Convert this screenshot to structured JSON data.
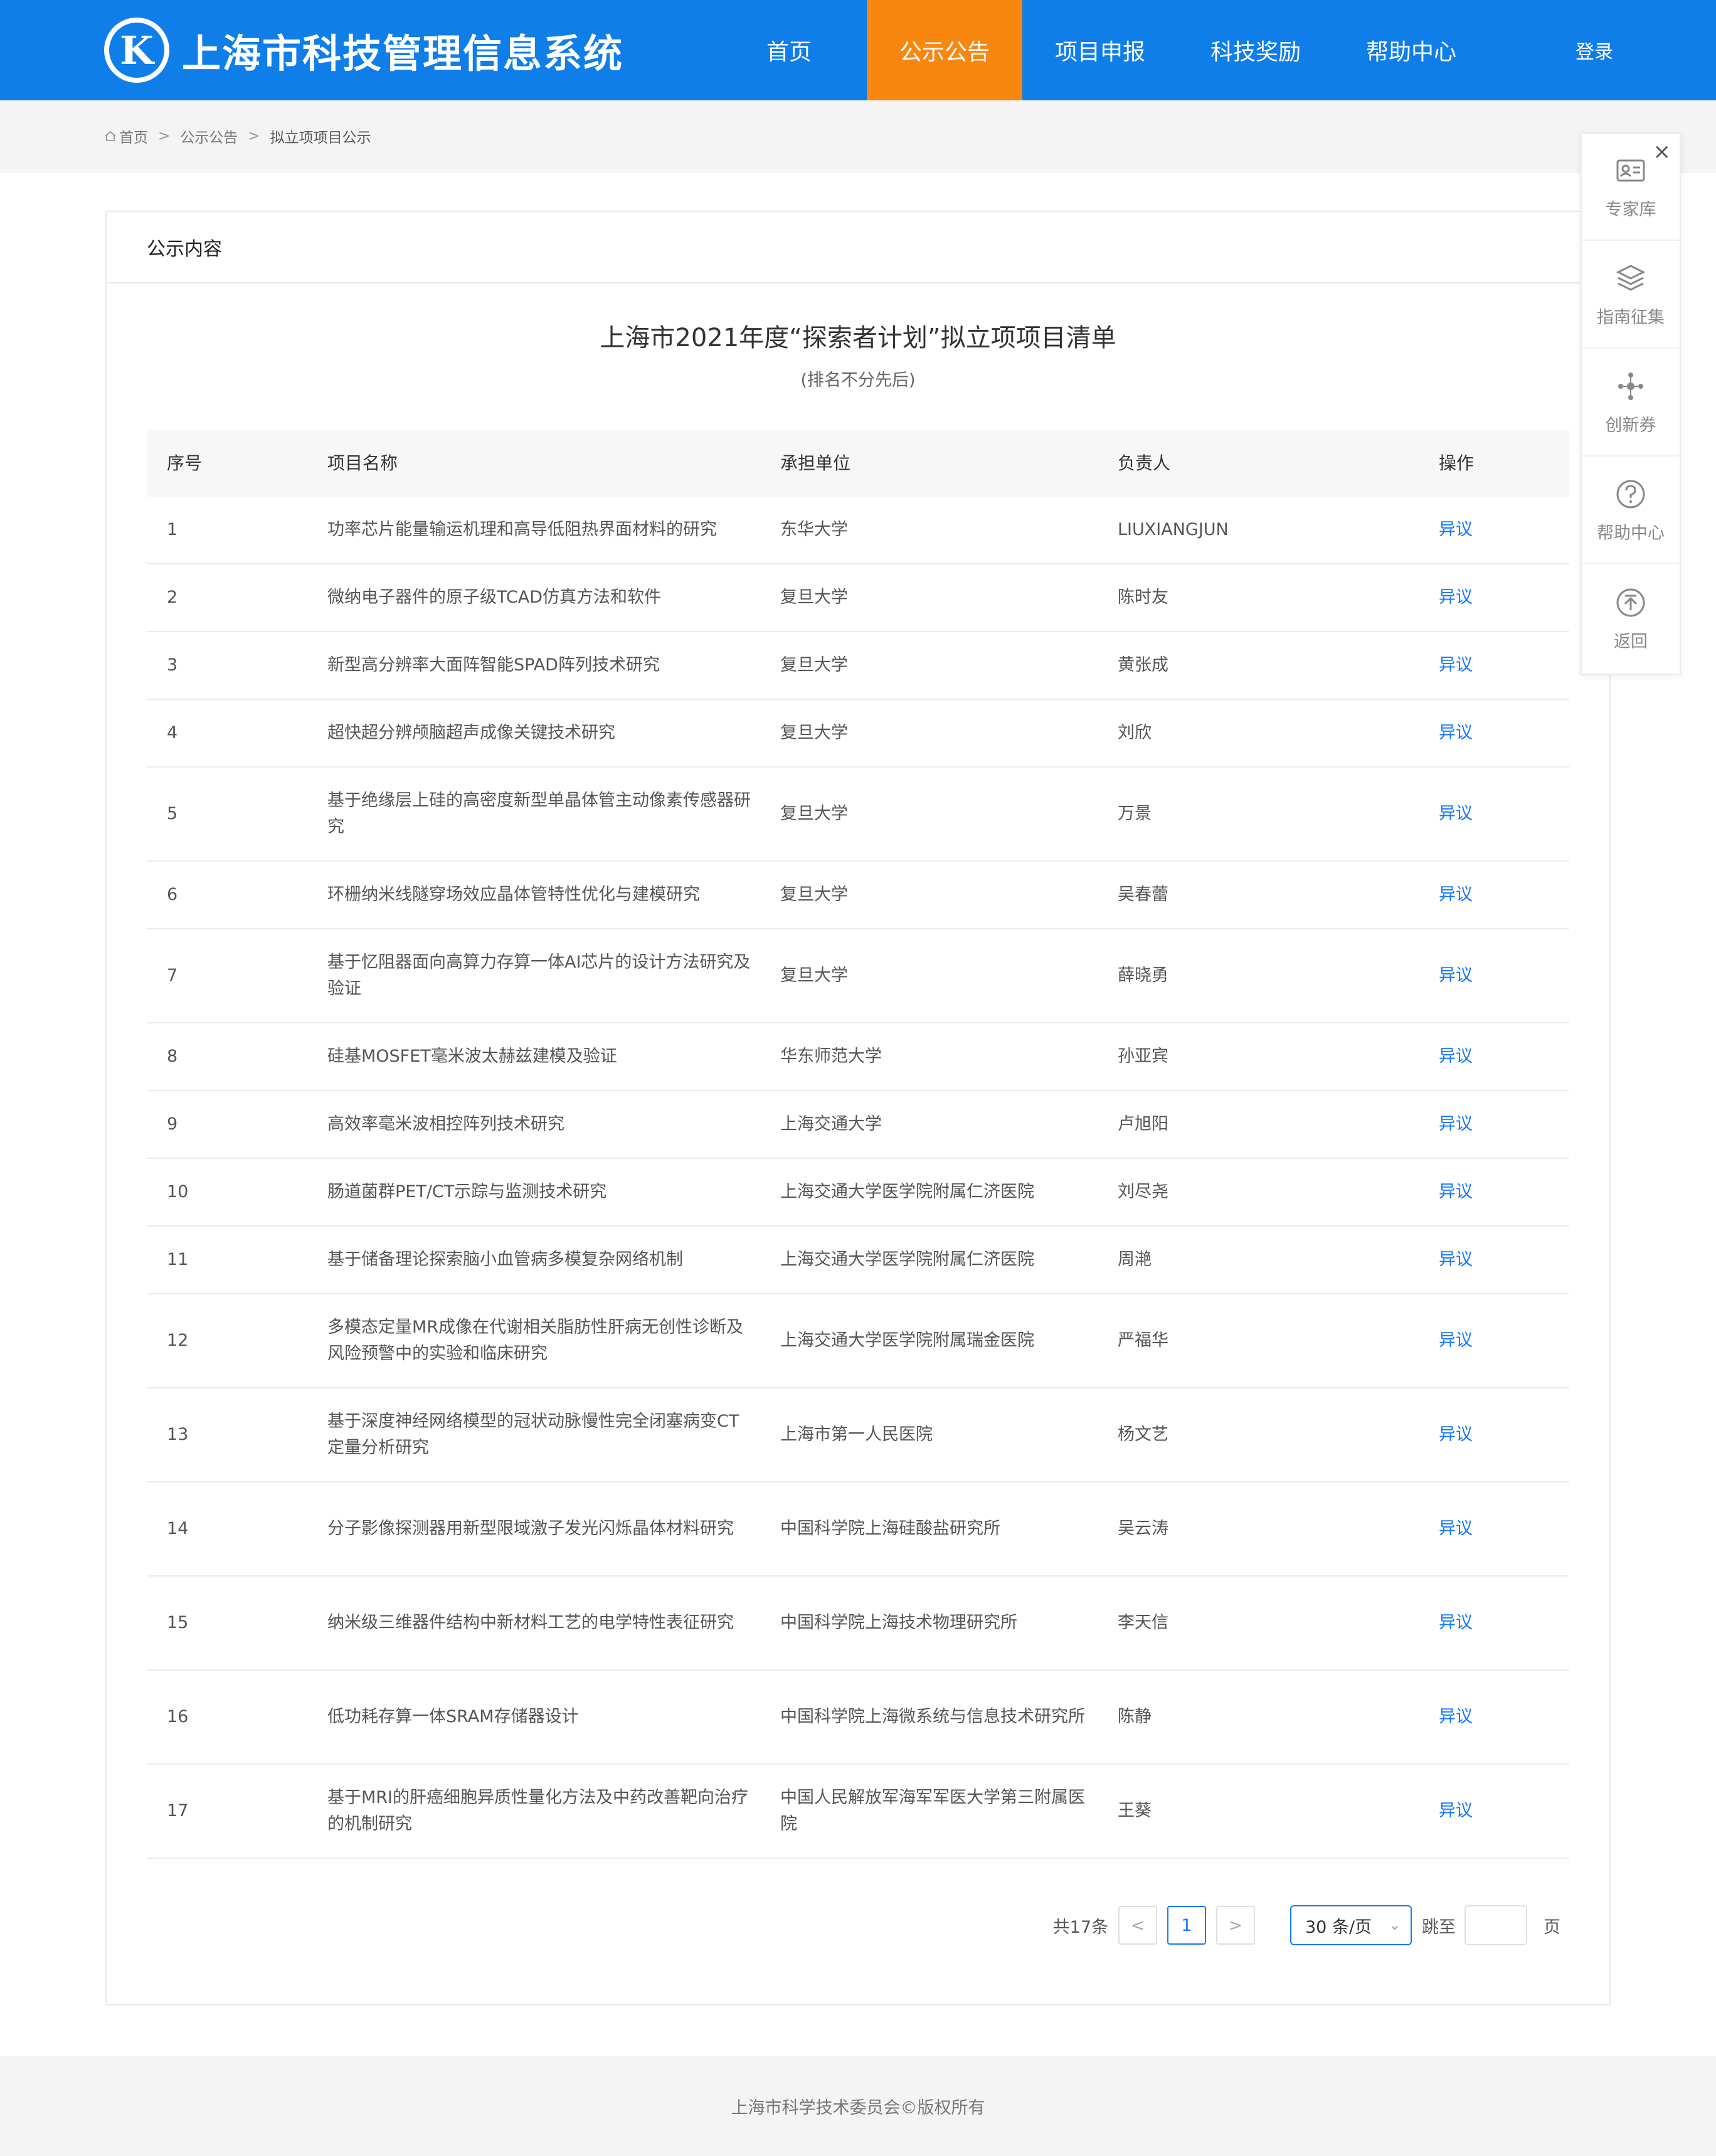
{
  "header": {
    "logo_letter": "K",
    "site_title": "上海市科技管理信息系统",
    "nav": [
      {
        "label": "首页",
        "active": false
      },
      {
        "label": "公示公告",
        "active": true
      },
      {
        "label": "项目申报",
        "active": false
      },
      {
        "label": "科技奖励",
        "active": false
      },
      {
        "label": "帮助中心",
        "active": false
      }
    ],
    "login_label": "登录",
    "brand_color": "#0f7ee8",
    "active_color": "#f7870f"
  },
  "breadcrumb": {
    "items": [
      "首页",
      "公示公告",
      "拟立项项目公示"
    ],
    "separator": ">"
  },
  "panel": {
    "heading": "公示内容",
    "title": "上海市2021年度“探索者计划”拟立项项目清单",
    "subtitle": "(排名不分先后)"
  },
  "table": {
    "headers": [
      "序号",
      "项目名称",
      "承担单位",
      "负责人",
      "操作"
    ],
    "rows": [
      {
        "no": "1",
        "name": "功率芯片能量输运机理和高导低阻热界面材料的研究",
        "unit": "东华大学",
        "leader": "LIUXIANGJUN",
        "action": "异议"
      },
      {
        "no": "2",
        "name": "微纳电子器件的原子级TCAD仿真方法和软件",
        "unit": "复旦大学",
        "leader": "陈时友",
        "action": "异议"
      },
      {
        "no": "3",
        "name": "新型高分辨率大面阵智能SPAD阵列技术研究",
        "unit": "复旦大学",
        "leader": "黄张成",
        "action": "异议"
      },
      {
        "no": "4",
        "name": "超快超分辨颅脑超声成像关键技术研究",
        "unit": "复旦大学",
        "leader": "刘欣",
        "action": "异议"
      },
      {
        "no": "5",
        "name": "基于绝缘层上硅的高密度新型单晶体管主动像素传感器研究",
        "unit": "复旦大学",
        "leader": "万景",
        "action": "异议"
      },
      {
        "no": "6",
        "name": "环栅纳米线隧穿场效应晶体管特性优化与建模研究",
        "unit": "复旦大学",
        "leader": "吴春蕾",
        "action": "异议"
      },
      {
        "no": "7",
        "name": "基于忆阻器面向高算力存算一体AI芯片的设计方法研究及验证",
        "unit": "复旦大学",
        "leader": "薛晓勇",
        "action": "异议"
      },
      {
        "no": "8",
        "name": "硅基MOSFET毫米波太赫兹建模及验证",
        "unit": "华东师范大学",
        "leader": "孙亚宾",
        "action": "异议"
      },
      {
        "no": "9",
        "name": "高效率毫米波相控阵列技术研究",
        "unit": "上海交通大学",
        "leader": "卢旭阳",
        "action": "异议"
      },
      {
        "no": "10",
        "name": "肠道菌群PET/CT示踪与监测技术研究",
        "unit": "上海交通大学医学院附属仁济医院",
        "leader": "刘尽尧",
        "action": "异议"
      },
      {
        "no": "11",
        "name": "基于储备理论探索脑小血管病多模复杂网络机制",
        "unit": "上海交通大学医学院附属仁济医院",
        "leader": "周滟",
        "action": "异议"
      },
      {
        "no": "12",
        "name": "多模态定量MR成像在代谢相关脂肪性肝病无创性诊断及风险预警中的实验和临床研究",
        "unit": "上海交通大学医学院附属瑞金医院",
        "leader": "严福华",
        "action": "异议"
      },
      {
        "no": "13",
        "name": "基于深度神经网络模型的冠状动脉慢性完全闭塞病变CT定量分析研究",
        "unit": "上海市第一人民医院",
        "leader": "杨文艺",
        "action": "异议"
      },
      {
        "no": "14",
        "name": "分子影像探测器用新型限域激子发光闪烁晶体材料研究",
        "unit": "中国科学院上海硅酸盐研究所",
        "leader": "吴云涛",
        "action": "异议"
      },
      {
        "no": "15",
        "name": "纳米级三维器件结构中新材料工艺的电学特性表征研究",
        "unit": "中国科学院上海技术物理研究所",
        "leader": "李天信",
        "action": "异议"
      },
      {
        "no": "16",
        "name": "低功耗存算一体SRAM存储器设计",
        "unit": "中国科学院上海微系统与信息技术研究所",
        "leader": "陈静",
        "action": "异议"
      },
      {
        "no": "17",
        "name": "基于MRI的肝癌细胞异质性量化方法及中药改善靶向治疗的机制研究",
        "unit": "中国人民解放军海军军医大学第三附属医院",
        "leader": "王葵",
        "action": "异议"
      }
    ],
    "link_color": "#1677ff"
  },
  "pagination": {
    "total": "共17条",
    "prev": "<",
    "current_page": "1",
    "next": ">",
    "page_size": "30 条/页",
    "jump_label": "跳至",
    "jump_value": "",
    "page_suffix": "页"
  },
  "side_menu": {
    "close": "×",
    "items": [
      {
        "label": "专家库",
        "icon": "id-card-icon"
      },
      {
        "label": "指南征集",
        "icon": "layers-icon"
      },
      {
        "label": "创新券",
        "icon": "network-icon"
      },
      {
        "label": "帮助中心",
        "icon": "question-circle-icon"
      },
      {
        "label": "返回",
        "icon": "back-to-top-icon"
      }
    ]
  },
  "footer": {
    "copyright": "上海市科学技术委员会©版权所有"
  }
}
